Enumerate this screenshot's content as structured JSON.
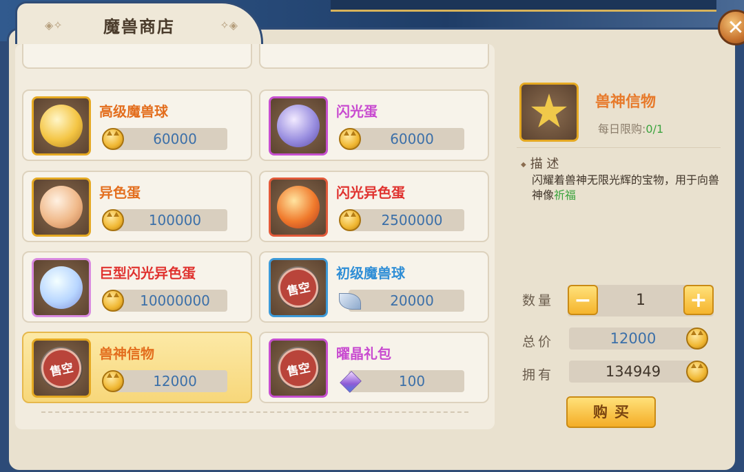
{
  "shop": {
    "title": "魔兽商店",
    "close_symbol": "✕"
  },
  "items": [
    {
      "name": "高级魔兽球",
      "price": "60000",
      "name_color": "#e36e1e",
      "currency": "cat-coin",
      "sold_out": false
    },
    {
      "name": "闪光蛋",
      "price": "60000",
      "name_color": "#c84ad0",
      "currency": "cat-coin",
      "sold_out": false
    },
    {
      "name": "异色蛋",
      "price": "100000",
      "name_color": "#e36e1e",
      "currency": "cat-coin",
      "sold_out": false
    },
    {
      "name": "闪光异色蛋",
      "price": "2500000",
      "name_color": "#e0322f",
      "currency": "cat-coin",
      "sold_out": false
    },
    {
      "name": "巨型闪光异色蛋",
      "price": "10000000",
      "name_color": "#e0322f",
      "currency": "cat-coin",
      "sold_out": false
    },
    {
      "name": "初级魔兽球",
      "price": "20000",
      "name_color": "#2f8ed6",
      "currency": "leaf",
      "sold_out": true,
      "sold_out_label": "售空"
    },
    {
      "name": "兽神信物",
      "price": "12000",
      "name_color": "#e36e1e",
      "currency": "cat-coin",
      "sold_out": true,
      "sold_out_label": "售空",
      "selected": true
    },
    {
      "name": "曜晶礼包",
      "price": "100",
      "name_color": "#c84ad0",
      "currency": "crystal",
      "sold_out": true,
      "sold_out_label": "售空"
    }
  ],
  "detail": {
    "name": "兽神信物",
    "limit_label": "每日限购:",
    "limit_value": "0/1",
    "desc_label": "描 述",
    "desc_text": "闪耀着兽神无限光辉的宝物，用于向兽神像",
    "desc_highlight": "祈福",
    "quantity_label": "数量",
    "quantity": "1",
    "minus_symbol": "−",
    "plus_symbol": "+",
    "total_label": "总价",
    "total": "12000",
    "owned_label": "拥有",
    "owned": "134949",
    "buy_label": "购买"
  }
}
